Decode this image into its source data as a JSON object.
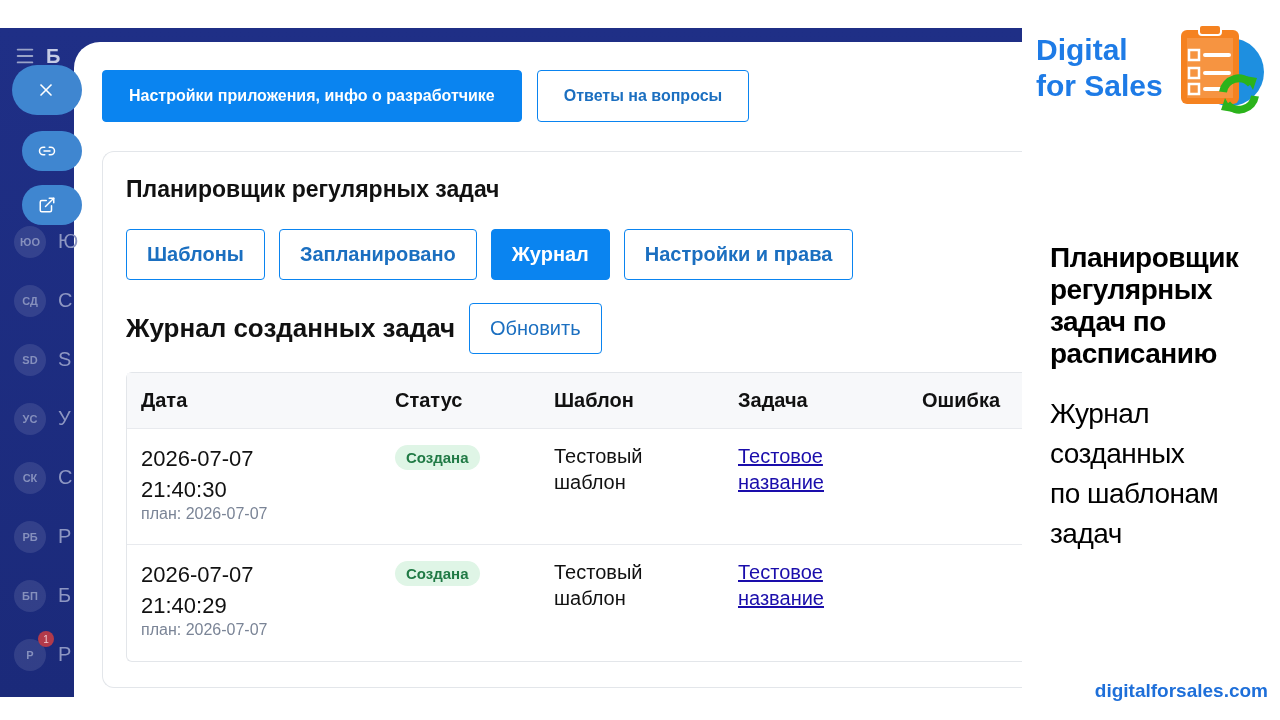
{
  "sidebar": {
    "header_letter": "Б",
    "items": [
      {
        "initials": "ЮО",
        "letter": "Ю"
      },
      {
        "initials": "СД",
        "letter": "С"
      },
      {
        "initials": "SD",
        "letter": "S"
      },
      {
        "initials": "УС",
        "letter": "У"
      },
      {
        "initials": "СК",
        "letter": "С"
      },
      {
        "initials": "РБ",
        "letter": "Р"
      },
      {
        "initials": "БП",
        "letter": "Б"
      },
      {
        "initials": "Р",
        "letter": "Р",
        "badge": "1"
      }
    ]
  },
  "modal": {
    "top_buttons": [
      {
        "label": "Настройки приложения, инфо о разработчике",
        "primary": true
      },
      {
        "label": "Ответы на вопросы",
        "primary": false
      }
    ],
    "card": {
      "title": "Планировщик регулярных задач",
      "tabs": [
        {
          "label": "Шаблоны",
          "selected": false
        },
        {
          "label": "Запланировано",
          "selected": false
        },
        {
          "label": "Журнал",
          "selected": true
        },
        {
          "label": "Настройки и права",
          "selected": false
        }
      ],
      "journal_title": "Журнал созданных задач",
      "refresh_button": "Обновить",
      "table": {
        "columns": [
          "Дата",
          "Статус",
          "Шаблон",
          "Задача",
          "Ошибка"
        ],
        "rows": [
          {
            "date": "2026-07-07",
            "time": "21:40:30",
            "plan": "план: 2026-07-07",
            "status": "Создана",
            "template": "Тестовый шаблон",
            "task": "Тестовое название"
          },
          {
            "date": "2026-07-07",
            "time": "21:40:29",
            "plan": "план: 2026-07-07",
            "status": "Создана",
            "template": "Тестовый шаблон",
            "task": "Тестовое название"
          }
        ]
      }
    }
  },
  "promo": {
    "brand": [
      "Digital",
      "for Sales"
    ],
    "headline": [
      "Планировщик",
      "регулярных",
      "задач по",
      "расписанию"
    ],
    "subtitle": [
      "Журнал",
      "созданных",
      "по шаблонам",
      "задач"
    ],
    "url": "digitalforsales.com"
  }
}
